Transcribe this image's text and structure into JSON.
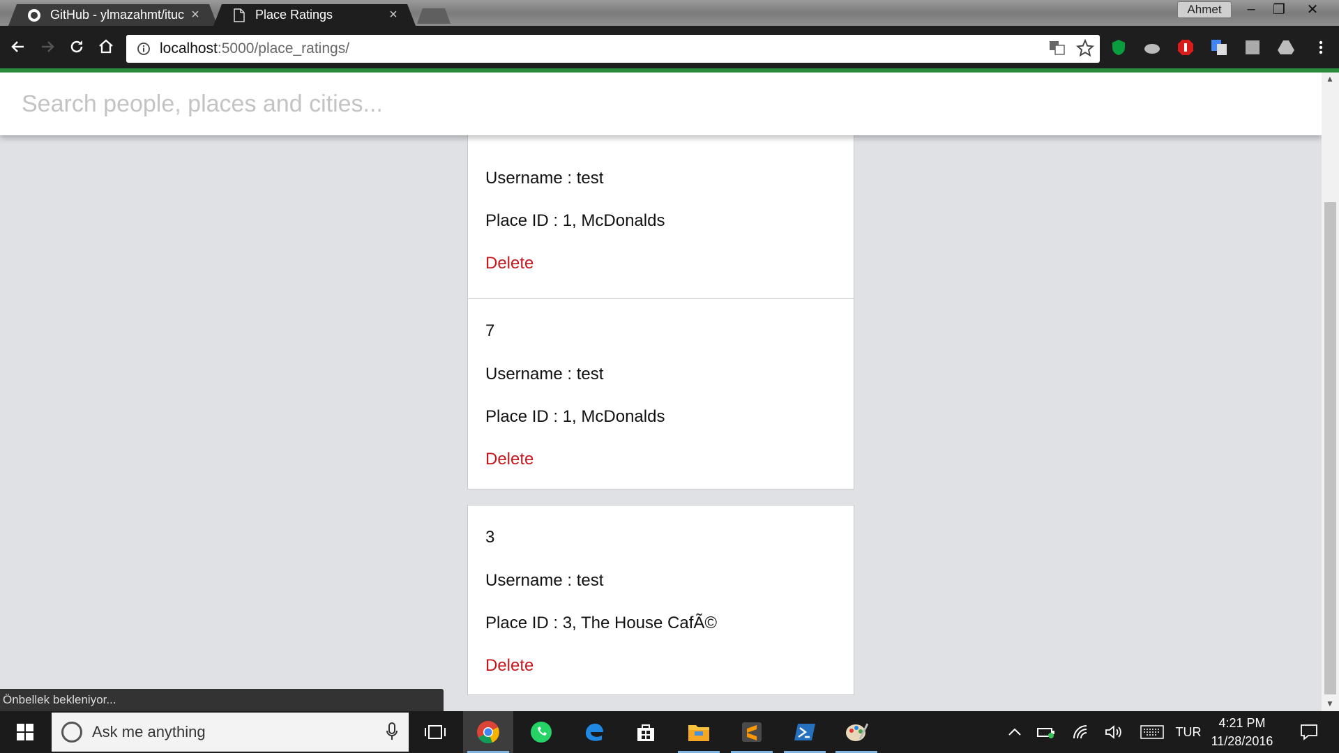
{
  "browser": {
    "tabs": [
      {
        "title": "GitHub - ylmazahmt/ituc",
        "close": "×"
      },
      {
        "title": "Place Ratings",
        "close": "×"
      }
    ],
    "profile_name": "Ahmet",
    "window_controls": {
      "minimize": "–",
      "restore": "❐",
      "close": "✕"
    },
    "url": {
      "host": "localhost",
      "path": ":5000/place_ratings/"
    }
  },
  "page": {
    "search_placeholder": "Search people, places and cities...",
    "cards": [
      {
        "id": "",
        "username": "Username : test",
        "place": "Place ID : 1, McDonalds",
        "delete": "Delete"
      },
      {
        "id": "7",
        "username": "Username : test",
        "place": "Place ID : 1, McDonalds",
        "delete": "Delete"
      },
      {
        "id": "3",
        "username": "Username : test",
        "place": "Place ID : 3, The House CafÃ©",
        "delete": "Delete"
      }
    ],
    "status_text": "Önbellek bekleniyor..."
  },
  "taskbar": {
    "search_placeholder": "Ask me anything",
    "language": "TUR",
    "time": "4:21 PM",
    "date": "11/28/2016"
  },
  "colors": {
    "delete_red": "#c5161d",
    "load_bar_green": "#2c8a3d",
    "page_background": "#dfe1e5"
  },
  "icons": [
    "github-icon",
    "page-icon",
    "back-arrow-icon",
    "forward-arrow-icon",
    "reload-icon",
    "home-icon",
    "info-icon",
    "translate-icon",
    "star-icon",
    "windows-start-icon",
    "microphone-icon",
    "task-view-icon",
    "chrome-icon",
    "whatsapp-icon",
    "edge-icon",
    "store-icon",
    "file-explorer-icon",
    "sublime-icon",
    "powershell-icon",
    "paint-icon"
  ]
}
